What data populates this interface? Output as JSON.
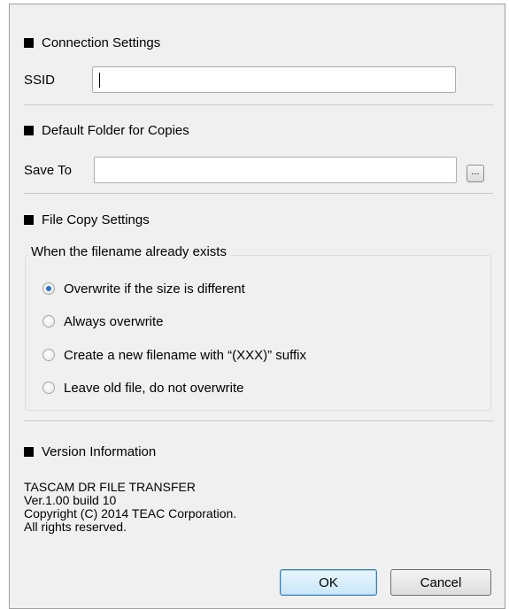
{
  "connection": {
    "heading": "Connection Settings",
    "ssid_label": "SSID",
    "ssid_value": ""
  },
  "default_folder": {
    "heading": "Default Folder for Copies",
    "save_to_label": "Save To",
    "save_to_value": "",
    "browse_label": "..."
  },
  "file_copy": {
    "heading": "File Copy Settings",
    "group_label": "When the filename already exists",
    "options": [
      {
        "label": "Overwrite if the size is different",
        "checked": true
      },
      {
        "label": "Always overwrite",
        "checked": false
      },
      {
        "label": "Create a new filename with “(XXX)” suffix",
        "checked": false
      },
      {
        "label": "Leave old file, do not overwrite",
        "checked": false
      }
    ]
  },
  "version": {
    "heading": "Version Information",
    "lines": [
      "TASCAM DR FILE TRANSFER",
      "Ver.1.00 build 10",
      "Copyright (C) 2014 TEAC Corporation.",
      "All rights reserved."
    ]
  },
  "buttons": {
    "ok": "OK",
    "cancel": "Cancel"
  }
}
